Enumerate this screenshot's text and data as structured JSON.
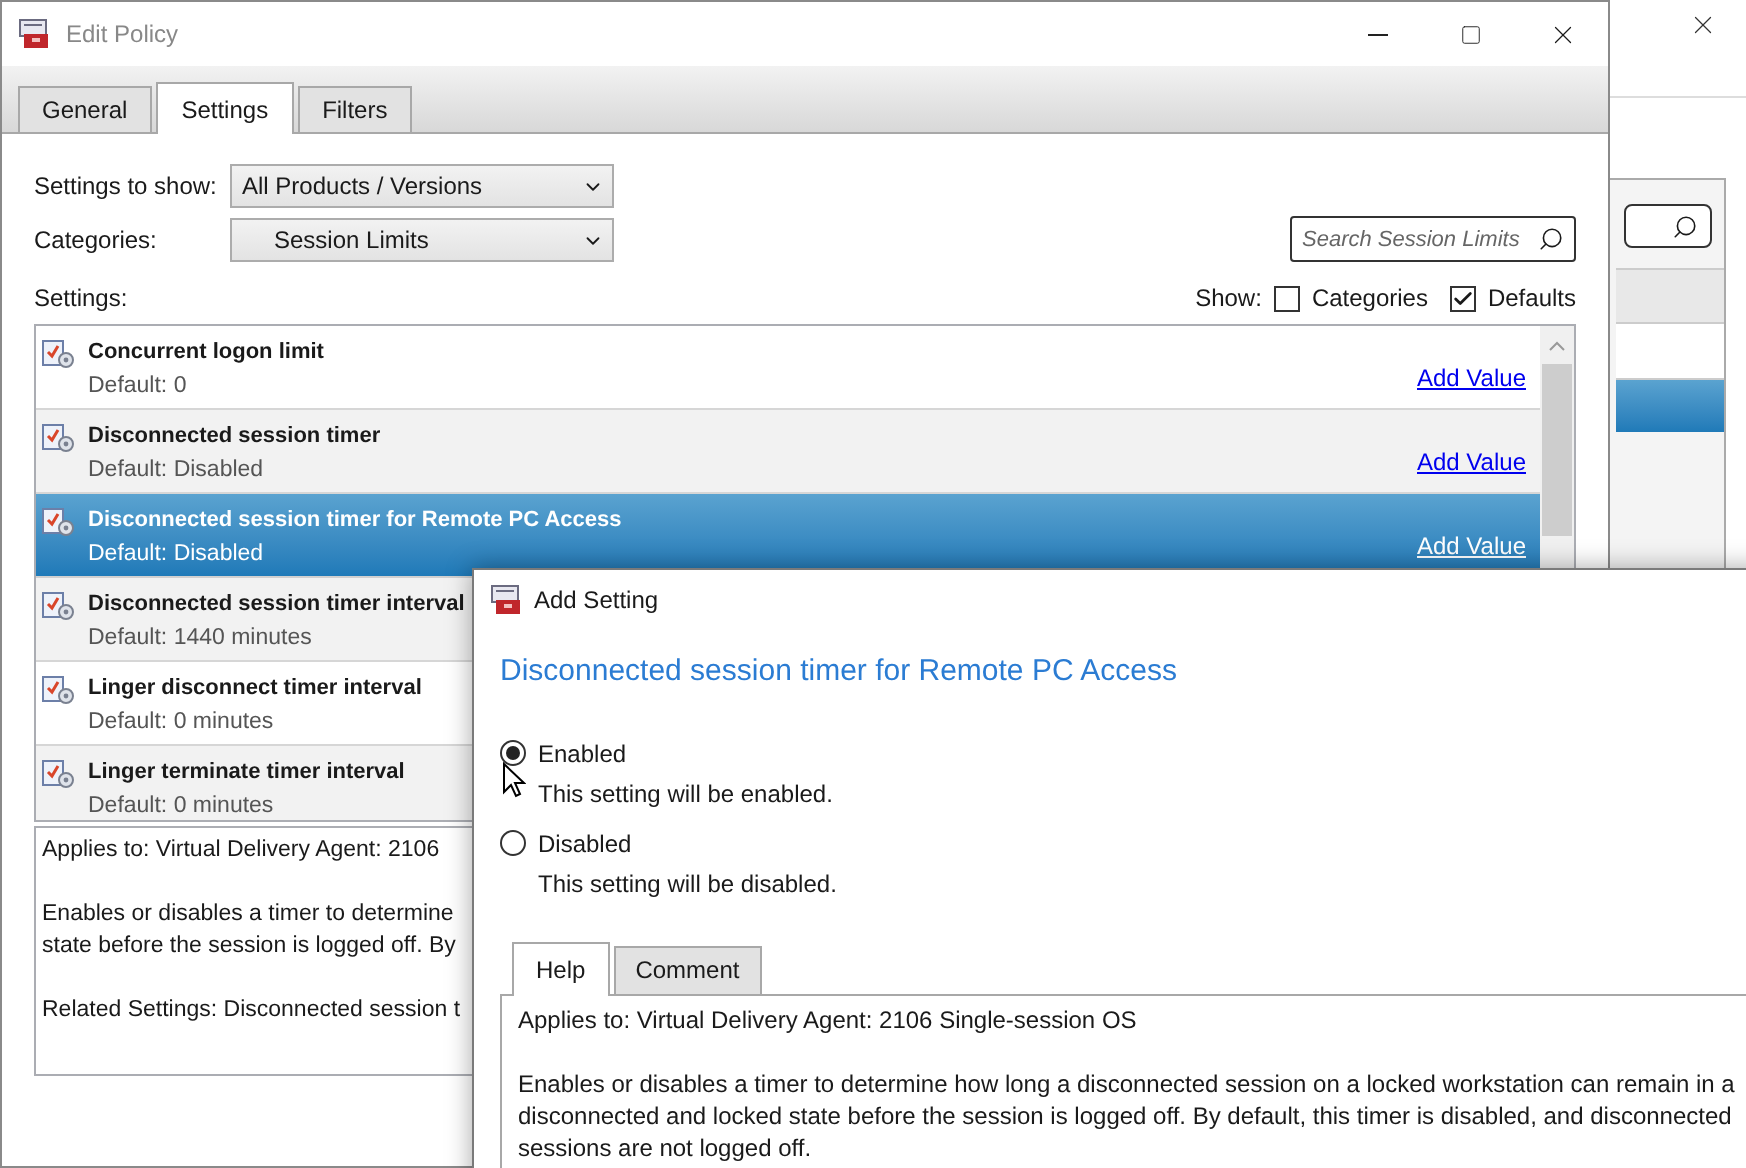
{
  "window": {
    "title": "Edit Policy"
  },
  "tabs": [
    {
      "label": "General",
      "selected": false
    },
    {
      "label": "Settings",
      "selected": true
    },
    {
      "label": "Filters",
      "selected": false
    }
  ],
  "filters": [
    {
      "label": "Settings to show:",
      "value": "All Products / Versions"
    },
    {
      "label": "Categories:",
      "value": "Session Limits"
    }
  ],
  "search": {
    "placeholder": "Search Session Limits"
  },
  "settings_label": "Settings:",
  "show": {
    "label": "Show:",
    "options": [
      {
        "label": "Categories",
        "checked": false
      },
      {
        "label": "Defaults",
        "checked": true
      }
    ]
  },
  "settings": [
    {
      "name": "Concurrent logon limit",
      "default": "Default: 0",
      "link": "Add Value",
      "selected": false
    },
    {
      "name": "Disconnected session timer",
      "default": "Default: Disabled",
      "link": "Add Value",
      "selected": false
    },
    {
      "name": "Disconnected session timer for Remote PC Access",
      "default": "Default: Disabled",
      "link": "Add Value",
      "selected": true
    },
    {
      "name": "Disconnected session timer interval",
      "default": "Default: 1440 minutes",
      "selected": false
    },
    {
      "name": "Linger disconnect timer interval",
      "default": "Default: 0 minutes",
      "selected": false
    },
    {
      "name": "Linger terminate timer interval",
      "default": "Default: 0 minutes",
      "selected": false
    }
  ],
  "description": [
    [
      "Applies to: Virtual Delivery Agent: 2106"
    ],
    [
      "Enables or disables a timer to determine",
      "state before the session is logged off. By"
    ],
    [
      "Related Settings: Disconnected session t"
    ]
  ],
  "dialog": {
    "title": "Add Setting",
    "heading": "Disconnected session timer for Remote PC Access",
    "options": [
      {
        "label": "Enabled",
        "hint": "This setting will be enabled.",
        "selected": true
      },
      {
        "label": "Disabled",
        "hint": "This setting will be disabled.",
        "selected": false
      }
    ],
    "tabs": [
      {
        "label": "Help",
        "selected": true
      },
      {
        "label": "Comment",
        "selected": false
      }
    ],
    "help": [
      "Applies to: Virtual Delivery Agent: 2106 Single-session OS",
      "Enables or disables a timer to determine how long a disconnected session on a locked workstation can remain in a disconnected and locked state before the session is logged off. By default, this timer is disabled, and disconnected sessions are not logged off."
    ]
  }
}
